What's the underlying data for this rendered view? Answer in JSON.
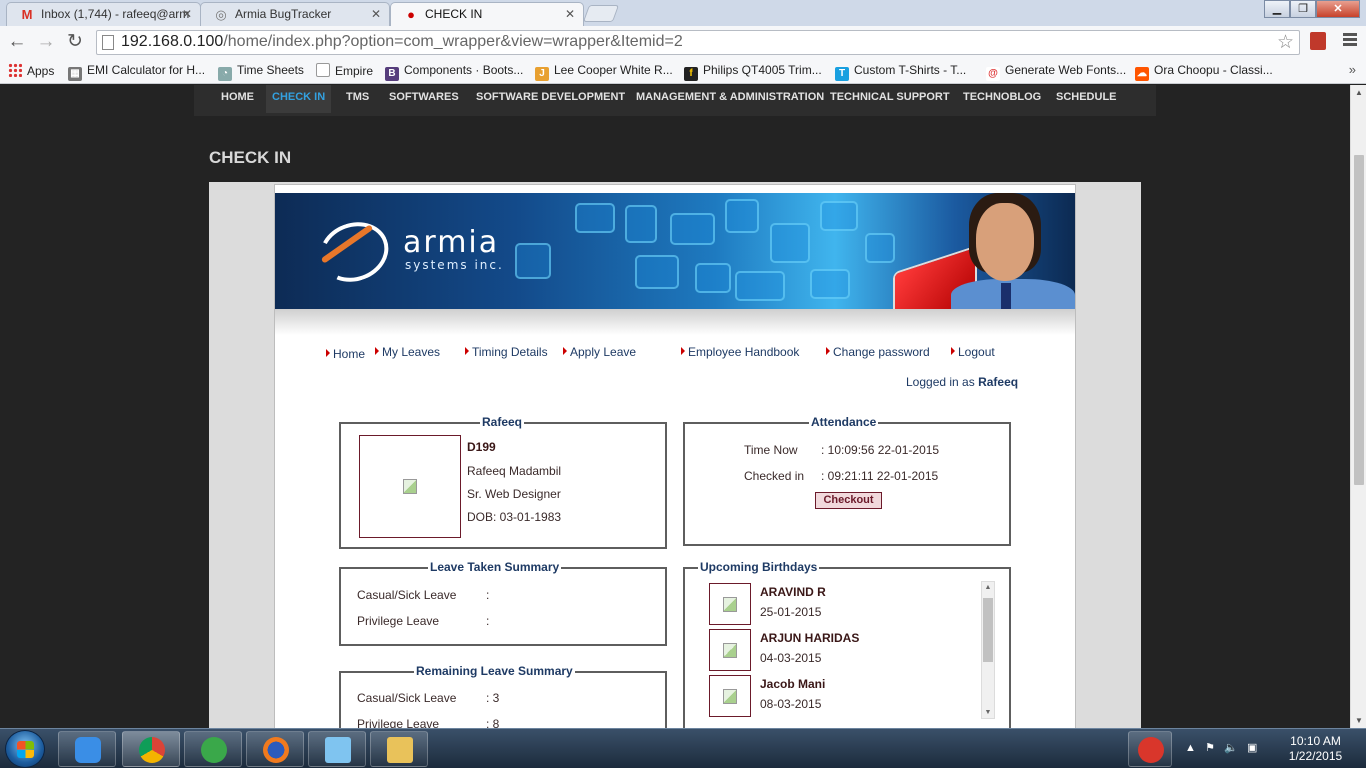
{
  "browser": {
    "tabs": [
      {
        "title": "Inbox (1,744) - rafeeq@arm",
        "icon": "gmail-icon"
      },
      {
        "title": "Armia BugTracker",
        "icon": "bugtracker-icon"
      },
      {
        "title": "CHECK IN",
        "icon": "armia-icon"
      }
    ],
    "url_host": "192.168.0.100",
    "url_path": "/home/index.php?option=com_wrapper&view=wrapper&Itemid=2",
    "bookmarks": [
      "Apps",
      "EMI Calculator for H...",
      "Time Sheets",
      "Empire",
      "Components · Boots...",
      "Lee Cooper White R...",
      "Philips QT4005 Trim...",
      "Custom T-Shirts - T...",
      "Generate Web Fonts...",
      "Ora Choopu - Classi..."
    ]
  },
  "site": {
    "nav": [
      "HOME",
      "CHECK IN",
      "TMS",
      "SOFTWARES",
      "SOFTWARE DEVELOPMENT",
      "MANAGEMENT & ADMINISTRATION",
      "TECHNICAL SUPPORT",
      "TECHNOBLOG",
      "SCHEDULE"
    ],
    "active_nav": "CHECK IN",
    "page_title": "CHECK IN"
  },
  "app": {
    "logo": "armia",
    "logo_sub": "systems inc.",
    "links": [
      "Home",
      "My Leaves",
      "Timing Details",
      "Apply Leave",
      "Employee Handbook",
      "Change password",
      "Logout"
    ],
    "logged_in_prefix": "Logged in as",
    "logged_in_user": "Rafeeq",
    "profile": {
      "legend": "Rafeeq",
      "emp_id": "D199",
      "name": "Rafeeq Madambil",
      "designation": "Sr. Web Designer",
      "dob": "DOB: 03-01-1983"
    },
    "attendance": {
      "legend": "Attendance",
      "time_now_label": "Time Now",
      "time_now_value": ": 10:09:56 22-01-2015",
      "checked_in_label": "Checked in",
      "checked_in_value": ": 09:21:11 22-01-2015",
      "checkout_label": "Checkout"
    },
    "leave_taken": {
      "legend": "Leave Taken Summary",
      "rows": [
        {
          "label": "Casual/Sick Leave",
          "value": ":"
        },
        {
          "label": "Privilege Leave",
          "value": ":"
        }
      ]
    },
    "remaining_leave": {
      "legend": "Remaining Leave Summary",
      "rows": [
        {
          "label": "Casual/Sick Leave",
          "value": ": 3"
        },
        {
          "label": "Privilege Leave",
          "value": ": 8"
        }
      ]
    },
    "birthdays": {
      "legend": "Upcoming Birthdays",
      "items": [
        {
          "name": "ARAVIND R",
          "date": "25-01-2015"
        },
        {
          "name": "ARJUN HARIDAS",
          "date": "04-03-2015"
        },
        {
          "name": "Jacob Mani",
          "date": "08-03-2015"
        }
      ]
    }
  },
  "taskbar": {
    "clock_time": "10:10 AM",
    "clock_date": "1/22/2015"
  },
  "colors": {
    "link": "#1e3a64",
    "nav_active": "#33a1e0",
    "fieldset_border": "#5e5e5e",
    "accent_red": "#cc0000"
  }
}
